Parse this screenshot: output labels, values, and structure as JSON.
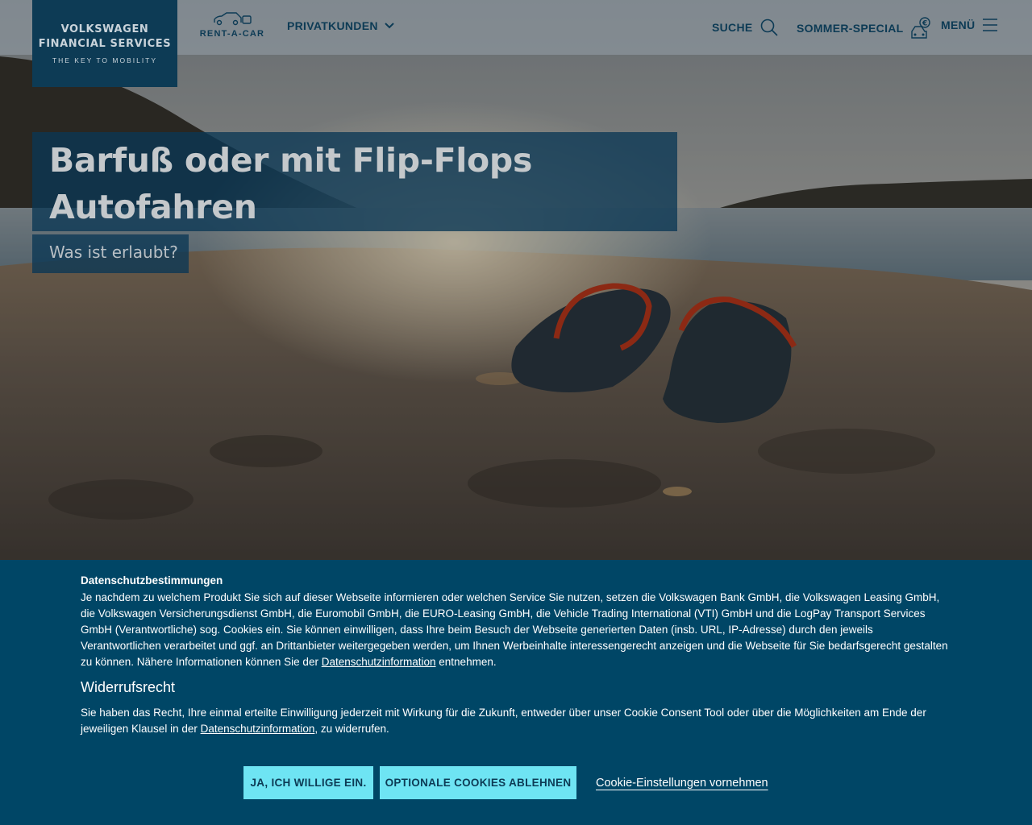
{
  "header": {
    "logo": {
      "line1": "VOLKSWAGEN",
      "line2": "FINANCIAL SERVICES",
      "tagline": "THE KEY TO MOBILITY"
    },
    "rent_a_car": {
      "label": "RENT-A-CAR",
      "icon": "car-key-icon"
    },
    "nav": {
      "privatkunden": "PRIVATKUNDEN",
      "suche": "SUCHE",
      "sommer_special": "SOMMER-SPECIAL",
      "menu": "MENÜ"
    },
    "icons": {
      "privatkunden": "chevron-down-icon",
      "suche": "search-icon",
      "sommer_special": "car-euro-icon",
      "menu": "hamburger-icon"
    }
  },
  "hero": {
    "headline_line1": "Barfuß oder mit Flip-Flops",
    "headline_line2": "Autofahren",
    "subline": "Was ist erlaubt?"
  },
  "cookie_banner": {
    "title": "Datenschutzbestimmungen",
    "text_before_link": "Je nachdem zu welchem Produkt Sie sich auf dieser Webseite informieren oder welchen Service Sie nutzen, setzen die Volkswagen Bank GmbH, die Volkswagen Leasing GmbH, die Volkswagen Versicherungsdienst GmbH, die Euromobil GmbH, die EURO-Leasing GmbH, die Vehicle Trading International (VTI) GmbH und die LogPay Transport Services GmbH (Verantwortliche) sog. Cookies ein. Sie können einwilligen, dass Ihre beim Besuch der Webseite generierten Daten (insb. URL, IP-Adresse) durch den jeweils Verantwortlichen verarbeitet und ggf. an Drittanbieter weitergegeben werden, um Ihnen Werbeinhalte interessengerecht anzeigen und die Webseite für Sie bedarfsgerecht gestalten zu können. Nähere Informationen können Sie der ",
    "link1": "Datenschutzinformation",
    "text_after_link": " entnehmen.",
    "widerruf_heading": "Widerrufsrecht",
    "widerruf_before_link": "Sie haben das Recht, Ihre einmal erteilte Einwilligung jederzeit mit Wirkung für die Zukunft, entweder über unser Cookie Consent Tool oder über die Möglichkeiten am Ende der jeweiligen Klausel in der ",
    "link2": "Datenschutzinformation",
    "widerruf_after_link": ", zu widerrufen.",
    "btn_accept": "JA, ICH WILLIGE EIN.",
    "btn_decline": "OPTIONALE COOKIES ABLEHNEN",
    "btn_settings": "Cookie-Einstellungen vornehmen"
  },
  "colors": {
    "brand_dark": "#0d3b55",
    "banner_bg": "#004666",
    "button_accent": "#6ee4f3"
  }
}
